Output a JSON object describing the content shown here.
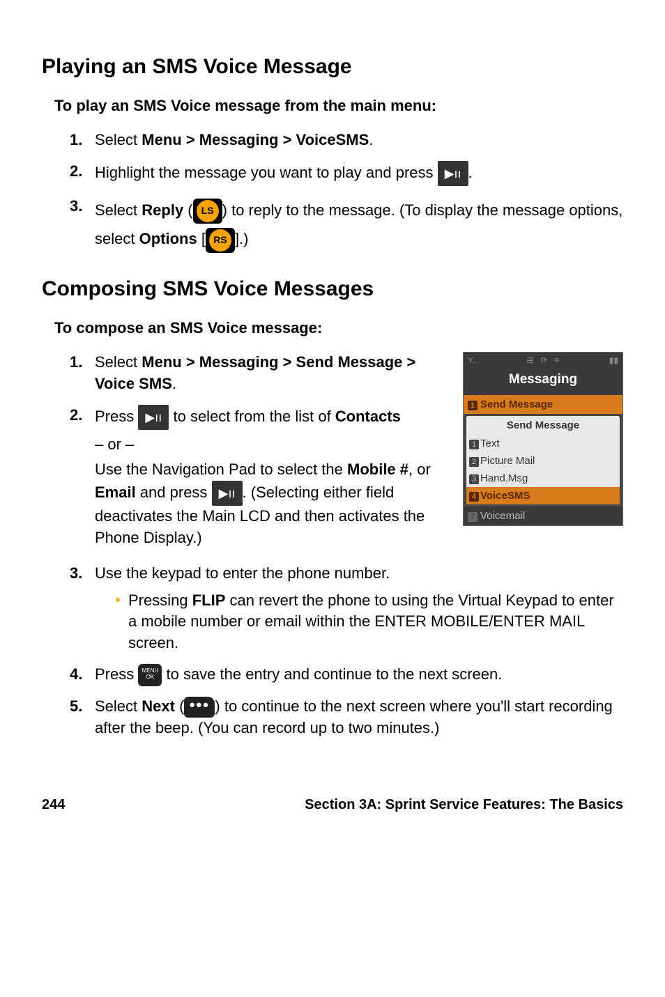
{
  "section1": {
    "heading": "Playing an SMS Voice Message",
    "intro": "To play an SMS Voice message from the main menu:",
    "steps": {
      "s1num": "1.",
      "s1a": "Select ",
      "s1b": "Menu > Messaging > VoiceSMS",
      "s1c": ".",
      "s2num": "2.",
      "s2a": "Highlight the message you want to play and press ",
      "s2c": ".",
      "s3num": "3.",
      "s3a": "Select ",
      "s3b": "Reply",
      "s3c": " (",
      "s3d": ") to reply to the message. (To display the message options, select ",
      "s3e": "Options",
      "s3f": " [",
      "s3g": "].)"
    }
  },
  "section2": {
    "heading": "Composing SMS Voice Messages",
    "intro": "To compose an SMS Voice message:",
    "steps": {
      "s1num": "1.",
      "s1a": "Select ",
      "s1b": "Menu > Messaging > Send Message > Voice SMS",
      "s1c": ".",
      "s2num": "2.",
      "s2a": "Press ",
      "s2b": " to select from the list of ",
      "s2c": "Contacts",
      "s2or": "– or –",
      "s2d": "Use the Navigation Pad to select the ",
      "s2e": "Mobile #",
      "s2f": ", or ",
      "s2g": "Email",
      "s2h": " and press ",
      "s2i": ". (Selecting either field deactivates the Main LCD and then activates the Phone Display.)",
      "s3num": "3.",
      "s3a": "Use the keypad to enter the phone number.",
      "s3bullet_a": "Pressing ",
      "s3bullet_b": "FLIP",
      "s3bullet_c": " can revert the phone to using the Virtual Keypad to enter a mobile number or email within the ENTER MOBILE/ENTER MAIL screen.",
      "s4num": "4.",
      "s4a": "Press ",
      "s4b": " to save the entry and continue to the next screen.",
      "s5num": "5.",
      "s5a": "Select ",
      "s5b": "Next",
      "s5c": " (",
      "s5d": ") to continue to the next screen where you'll start recording after the beep. (You can record up to two minutes.)"
    }
  },
  "phone": {
    "title": "Messaging",
    "row1": "Send Message",
    "submenu_header": "Send Message",
    "sub1": "Text",
    "sub2": "Picture Mail",
    "sub3": "Hand.Msg",
    "sub4": "VoiceSMS",
    "row7": "Voicemail"
  },
  "icons": {
    "play": "▶ıı",
    "menu_line1": "MENU",
    "menu_line2": "OK",
    "dots": "•••"
  },
  "footer": {
    "page": "244",
    "label": "Section 3A: Sprint Service Features: The Basics"
  }
}
